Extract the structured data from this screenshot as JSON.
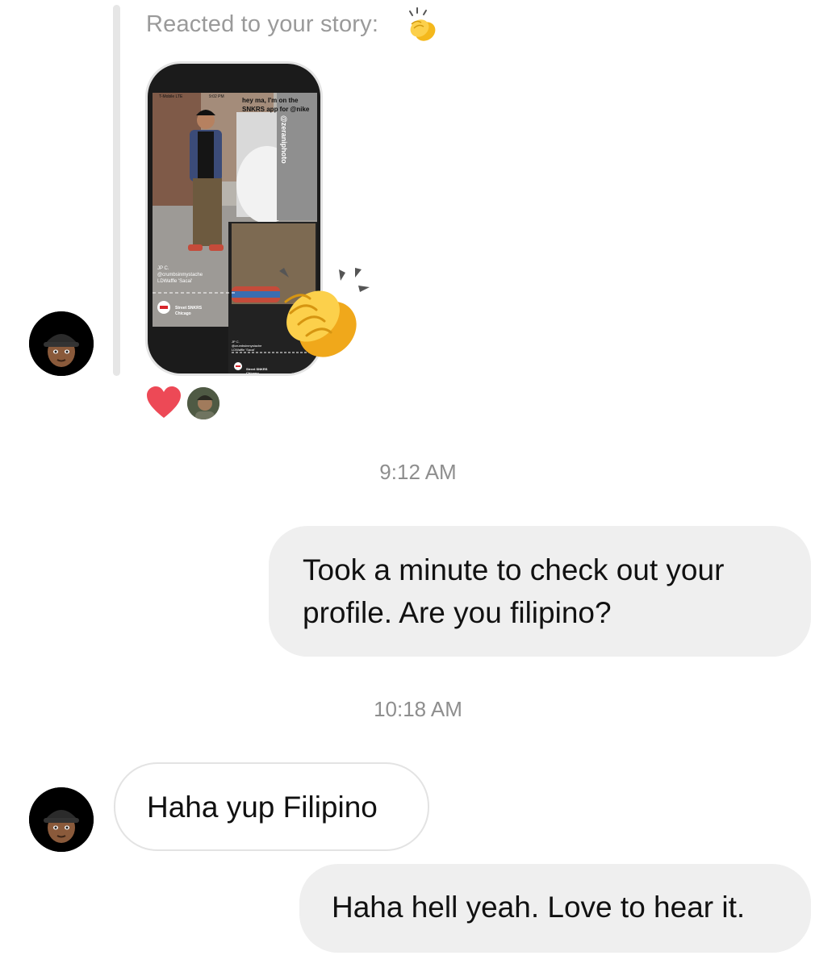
{
  "story_reply": {
    "reacted_label": "Reacted to your story:",
    "reaction_emoji": "clapping-hands",
    "story": {
      "status_carrier": "T-Mobile LTE",
      "status_time": "9:02 PM",
      "caption": "hey ma, I'm on the SNKRS app for @nike",
      "photo_credit": "@zeraniphoto",
      "person_name": "JP C.",
      "person_handle": "@crumbsinmystache",
      "shoe_name": "LDWaffle 'Sacai'",
      "app_title": "Street SNKRS",
      "app_location": "Chicago"
    },
    "reactions": [
      "heart",
      "avatar"
    ]
  },
  "messages": [
    {
      "type": "timestamp",
      "text": "9:12 AM"
    },
    {
      "type": "outgoing",
      "lines": [
        "Took a minute to check out your",
        "profile. Are you filipino?"
      ]
    },
    {
      "type": "timestamp",
      "text": "10:18 AM"
    },
    {
      "type": "incoming",
      "text": "Haha yup Filipino"
    },
    {
      "type": "outgoing",
      "text": "Haha hell yeah. Love to hear it."
    }
  ],
  "colors": {
    "outgoing_bubble": "#efefef",
    "incoming_border": "#e3e3e3",
    "timestamp": "#8e8e8e",
    "reacted_label": "#9a9a9a",
    "heart": "#ed4956"
  }
}
